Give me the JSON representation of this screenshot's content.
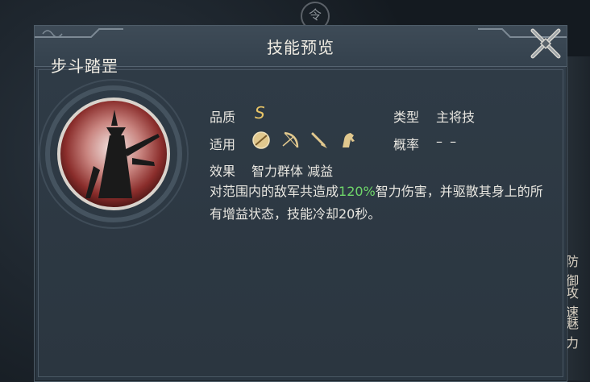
{
  "background": {
    "top_badge": "令",
    "right_labels": [
      "防御",
      "攻速",
      "魅力"
    ]
  },
  "dialog": {
    "title": "技能预览"
  },
  "skill": {
    "name": "步斗踏罡",
    "quality_label": "品质",
    "quality_value": "S",
    "type_label": "类型",
    "type_value": "主将技",
    "apply_label": "适用",
    "apply_icons": [
      "shield-icon",
      "bow-icon",
      "spear-icon",
      "horse-icon"
    ],
    "chance_label": "概率",
    "chance_value": "– –",
    "effect_label": "效果",
    "effect_value": "智力群体 减益",
    "description_before": "对范围内的敌军共造成",
    "description_highlight": "120%",
    "description_after": "智力伤害，并驱散其身上的所有增益状态，技能冷却20秒。"
  },
  "colors": {
    "quality": "#e9c567",
    "highlight": "#6fd66a",
    "panel": "#2f3b46"
  }
}
